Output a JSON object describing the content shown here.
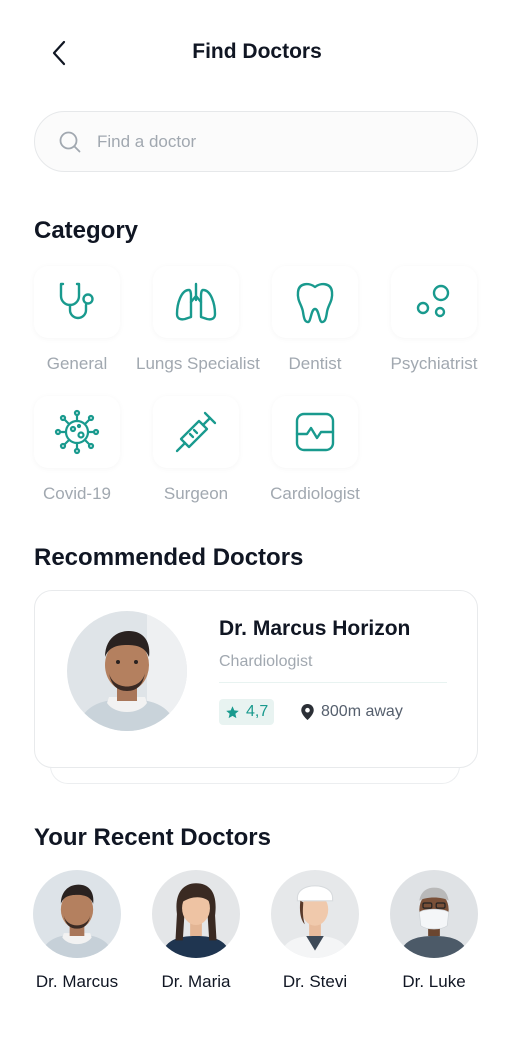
{
  "header": {
    "title": "Find Doctors",
    "back_icon": "chevron-left-icon"
  },
  "search": {
    "placeholder": "Find a doctor",
    "value": "",
    "icon": "search-icon"
  },
  "category": {
    "title": "Category",
    "items": [
      {
        "label": "General",
        "icon": "stethoscope-icon"
      },
      {
        "label": "Lungs Specialist",
        "icon": "lungs-icon"
      },
      {
        "label": "Dentist",
        "icon": "tooth-icon"
      },
      {
        "label": "Psychiatrist",
        "icon": "bubbles-icon"
      },
      {
        "label": "Covid-19",
        "icon": "virus-icon"
      },
      {
        "label": "Surgeon",
        "icon": "syringe-icon"
      },
      {
        "label": "Cardiologist",
        "icon": "heart-monitor-icon"
      }
    ]
  },
  "recommended": {
    "title": "Recommended Doctors",
    "doctor": {
      "name": "Dr. Marcus Horizon",
      "specialty": "Chardiologist",
      "rating": "4,7",
      "distance": "800m away"
    }
  },
  "recent": {
    "title": "Your Recent Doctors",
    "doctors": [
      {
        "name": "Dr. Marcus"
      },
      {
        "name": "Dr. Maria"
      },
      {
        "name": "Dr. Stevi"
      },
      {
        "name": "Dr. Luke"
      }
    ]
  },
  "colors": {
    "accent": "#199A8E",
    "accent_light": "#E8F3F1",
    "muted_text": "#A1A8B0",
    "text": "#101623"
  }
}
